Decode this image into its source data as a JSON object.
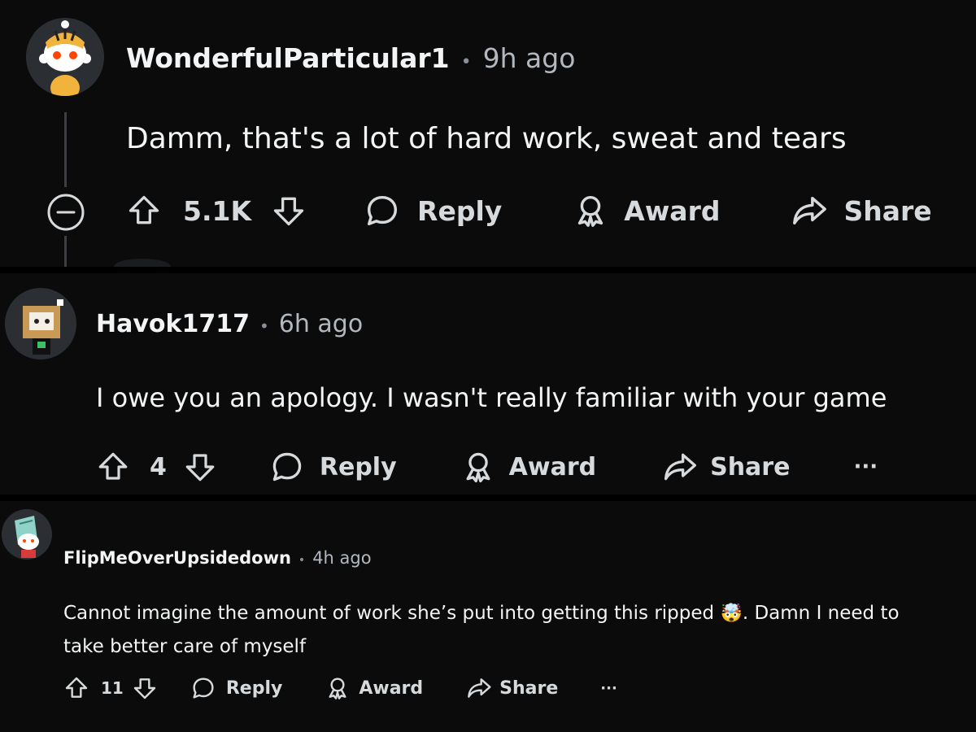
{
  "comments": [
    {
      "username": "WonderfulParticular1",
      "separator": "•",
      "time": "9h ago",
      "text": "Damm, that's a lot of hard work, sweat and tears",
      "votes": "5.1K",
      "reply": "Reply",
      "award": "Award",
      "share": "Share",
      "more": "···"
    },
    {
      "username": "Havok1717",
      "separator": "•",
      "time": "6h ago",
      "text": "I owe you an apology. I wasn't really familiar with your game",
      "votes": "4",
      "reply": "Reply",
      "award": "Award",
      "share": "Share",
      "more": "···"
    },
    {
      "username": "FlipMeOverUpsidedown",
      "separator": "•",
      "time": "4h ago",
      "text_line1": "Cannot imagine the amount of work she’s put into getting this ripped",
      "text_emoji": "🤯",
      "text_line1_end": ". Damn I need to",
      "text_line2": "take better care of myself",
      "votes": "11",
      "reply": "Reply",
      "award": "Award",
      "share": "Share",
      "more": "···"
    }
  ],
  "icons": {
    "collapse": "collapse-icon",
    "upvote": "upvote-icon",
    "downvote": "downvote-icon",
    "reply": "reply-icon",
    "award": "award-icon",
    "share": "share-icon",
    "more": "more-icon"
  },
  "colors": {
    "background": "#000000",
    "panel": "#0b0b0b",
    "text": "#f2f4f5",
    "muted": "#b3b8bf",
    "line": "#3b3f44"
  }
}
